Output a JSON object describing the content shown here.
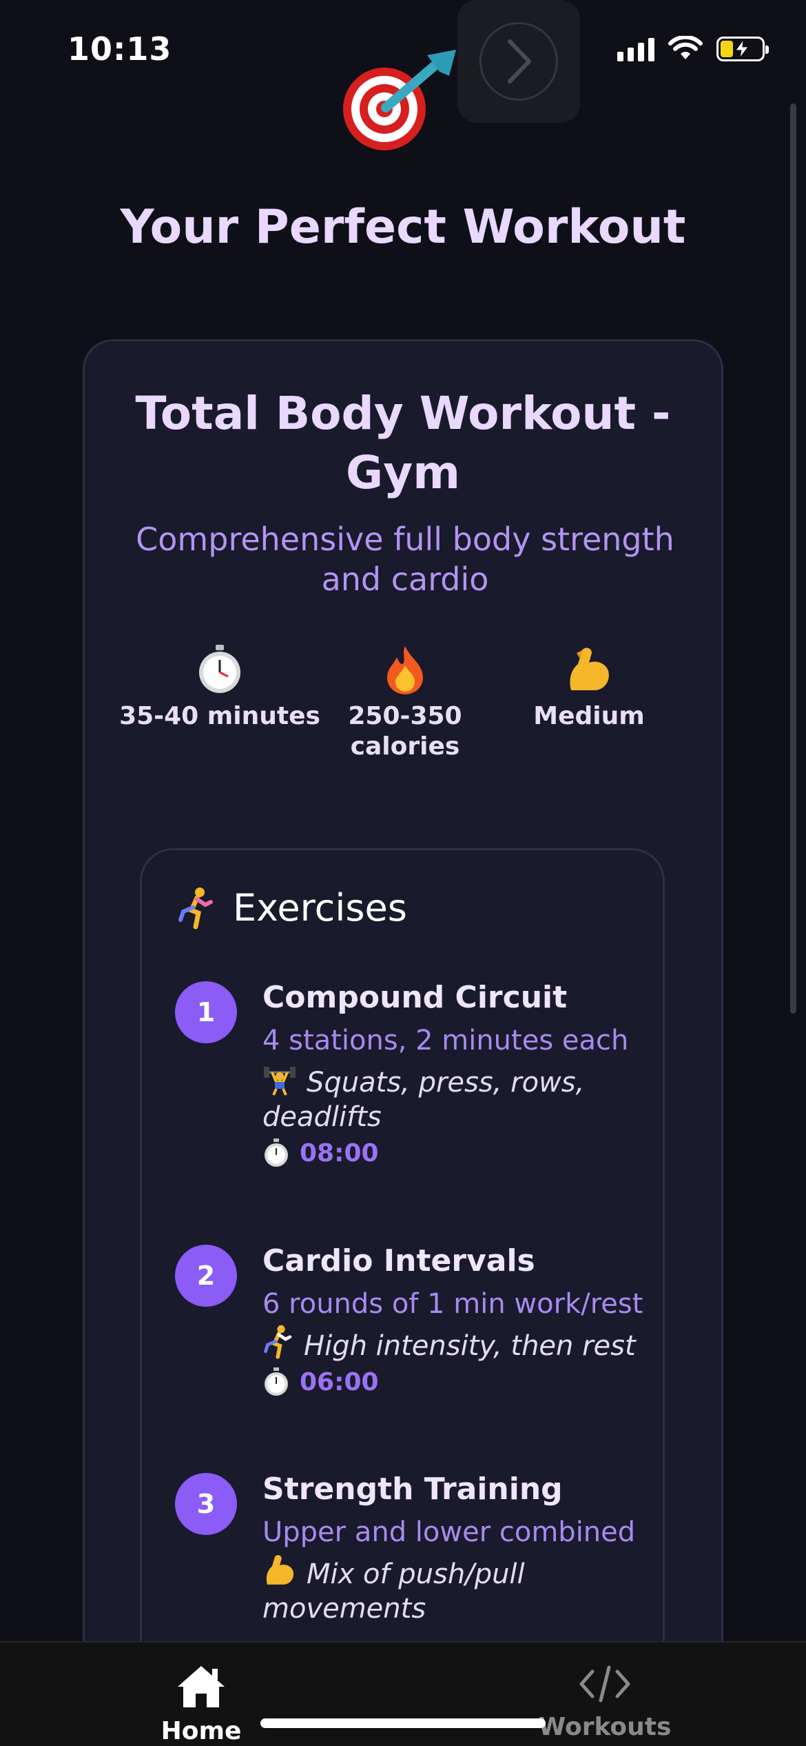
{
  "status_bar": {
    "time": "10:13"
  },
  "header": {
    "title": "Your Perfect Workout"
  },
  "workout": {
    "title_line1": "Total Body Workout -",
    "title_line2": "Gym",
    "subtitle": "Comprehensive full body strength and cardio",
    "stats": [
      {
        "icon": "stopwatch-icon",
        "label": "35-40 minutes"
      },
      {
        "icon": "fire-icon",
        "label": "250-350 calories"
      },
      {
        "icon": "flexed-bicep-icon",
        "label": "Medium"
      }
    ]
  },
  "exercises": {
    "header": "Exercises",
    "items": [
      {
        "number": "1",
        "name": "Compound Circuit",
        "detail": "4 stations, 2 minutes each",
        "description": "Squats, press, rows, deadlifts",
        "time": "08:00"
      },
      {
        "number": "2",
        "name": "Cardio Intervals",
        "detail": "6 rounds of 1 min work/rest",
        "description": "High intensity, then rest",
        "time": "06:00"
      },
      {
        "number": "3",
        "name": "Strength Training",
        "detail": "Upper and lower combined",
        "description": "Mix of push/pull movements",
        "time": ""
      }
    ]
  },
  "tabbar": {
    "tabs": [
      {
        "label": "Home",
        "active": true
      },
      {
        "label": "Workouts",
        "active": false
      }
    ],
    "active_color": "#ffffff",
    "inactive_color": "#8a8a8a"
  },
  "colors": {
    "accent": "#8b5cf6",
    "title": "#e9d8ff",
    "subtitle": "#b494f4"
  }
}
